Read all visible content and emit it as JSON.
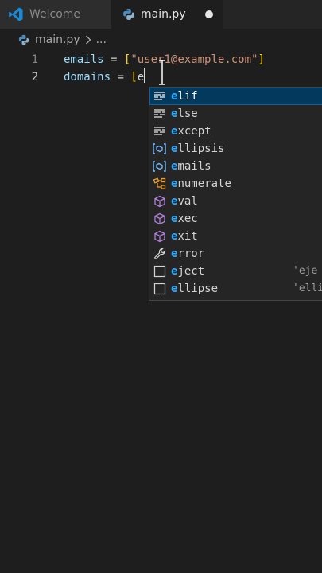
{
  "tabs": [
    {
      "label": "Welcome",
      "icon": "vscode-logo-icon"
    },
    {
      "label": "main.py",
      "icon": "python-icon",
      "dirty": true
    }
  ],
  "breadcrumb": {
    "file": "main.py",
    "more": "..."
  },
  "editor": {
    "lines": [
      {
        "number": "1",
        "text": "emails = [\"user1@example.com\"]"
      },
      {
        "number": "2",
        "text": "domains = [e"
      }
    ],
    "colors": {
      "variable": "#9cdcfe",
      "string": "#ce9178",
      "bracket": "#ffd700"
    }
  },
  "suggestions": {
    "query": "e",
    "items": [
      {
        "label": "elif",
        "kind": "keyword-snippet-icon",
        "detail": "",
        "selected": true
      },
      {
        "label": "else",
        "kind": "keyword-snippet-icon",
        "detail": ""
      },
      {
        "label": "except",
        "kind": "keyword-snippet-icon",
        "detail": ""
      },
      {
        "label": "ellipsis",
        "kind": "variable-icon",
        "detail": ""
      },
      {
        "label": "emails",
        "kind": "variable-icon",
        "detail": ""
      },
      {
        "label": "enumerate",
        "kind": "class-icon",
        "detail": ""
      },
      {
        "label": "eval",
        "kind": "method-cube-icon",
        "detail": ""
      },
      {
        "label": "exec",
        "kind": "method-cube-icon",
        "detail": ""
      },
      {
        "label": "exit",
        "kind": "method-cube-icon",
        "detail": ""
      },
      {
        "label": "error",
        "kind": "wrench-icon",
        "detail": ""
      },
      {
        "label": "eject",
        "kind": "snippet-box-icon",
        "detail": "'eje"
      },
      {
        "label": "ellipse",
        "kind": "snippet-box-icon",
        "detail": "'elli"
      }
    ]
  }
}
